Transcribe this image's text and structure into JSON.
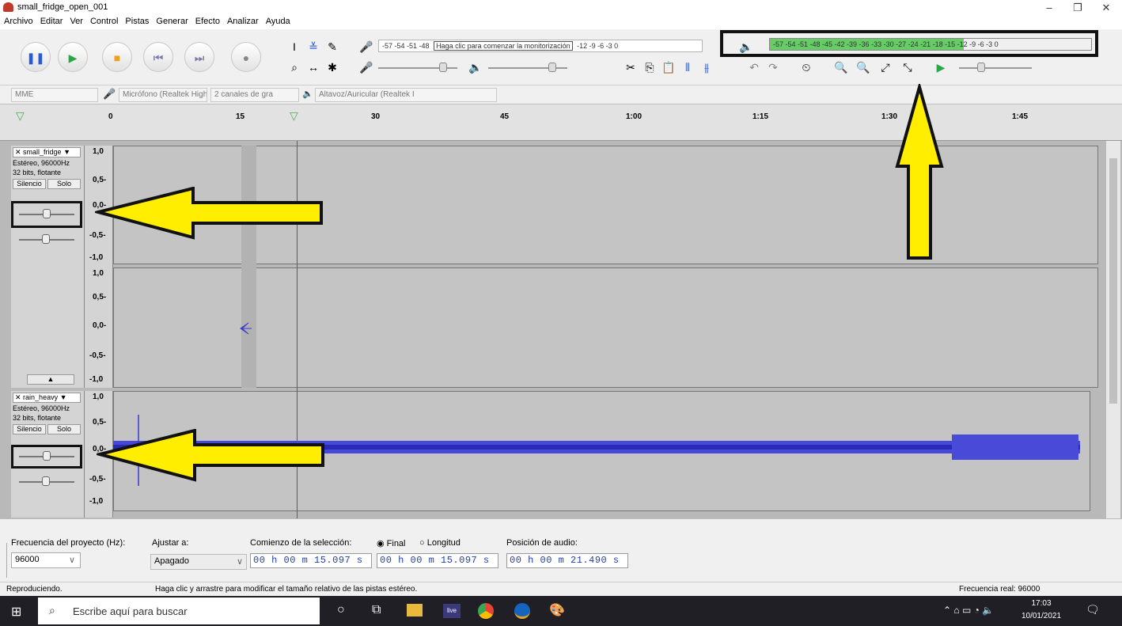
{
  "window": {
    "title": "small_fridge_open_001"
  },
  "menu": [
    "Archivo",
    "Editar",
    "Ver",
    "Control",
    "Pistas",
    "Generar",
    "Efecto",
    "Analizar",
    "Ayuda"
  ],
  "recording_meter": {
    "scale": "-57 -54 -51 -48",
    "prompt": "Haga clic para comenzar la monitorización",
    "scale_right": "-12  -9  -6  -3  0"
  },
  "playback_meter": {
    "scale": "-57 -54 -51 -48 -45 -42 -39 -36 -33 -30 -27 -24 -21 -18 -15 -12  -9  -6  -3  0"
  },
  "devices": {
    "host": "MME",
    "input": "Micrófono (Realtek High D",
    "channels": "2 canales de gra",
    "output": "Altavoz/Auricular (Realtek I"
  },
  "ruler": [
    "0",
    "15",
    "30",
    "45",
    "1:00",
    "1:15",
    "1:30",
    "1:45"
  ],
  "tracks": [
    {
      "name": "small_fridge",
      "info1": "Estéreo, 96000Hz",
      "info2": "32 bits, flotante",
      "mute": "Silencio",
      "solo": "Solo"
    },
    {
      "name": "rain_heavy",
      "info1": "Estéreo, 96000Hz",
      "info2": "32 bits, flotante",
      "mute": "Silencio",
      "solo": "Solo"
    }
  ],
  "axis": [
    "1,0",
    "0,5-",
    "0,0-",
    "-0,5-",
    "-1,0"
  ],
  "bottom": {
    "rate_label": "Frecuencia del proyecto (Hz):",
    "rate_value": "96000",
    "snap_label": "Ajustar a:",
    "snap_value": "Apagado",
    "sel_label": "Comienzo de la selección:",
    "opt_final": "Final",
    "opt_length": "Longitud",
    "pos_label": "Posición de audio:",
    "time1": "00 h 00 m 15.097 s",
    "time2": "00 h 00 m 15.097 s",
    "time3": "00 h 00 m 21.490 s"
  },
  "status": {
    "left": "Reproduciendo.",
    "middle": "Haga clic y arrastre para modificar el tamaño relativo de las pistas estéreo.",
    "right": "Frecuencia real: 96000"
  },
  "taskbar": {
    "search": "Escribe aquí para buscar",
    "time": "17:03",
    "date": "10/01/2021"
  },
  "colors": {
    "wave": "#3a3ad0",
    "meter_green": "#66cc66",
    "arrow": "#ffee00"
  }
}
